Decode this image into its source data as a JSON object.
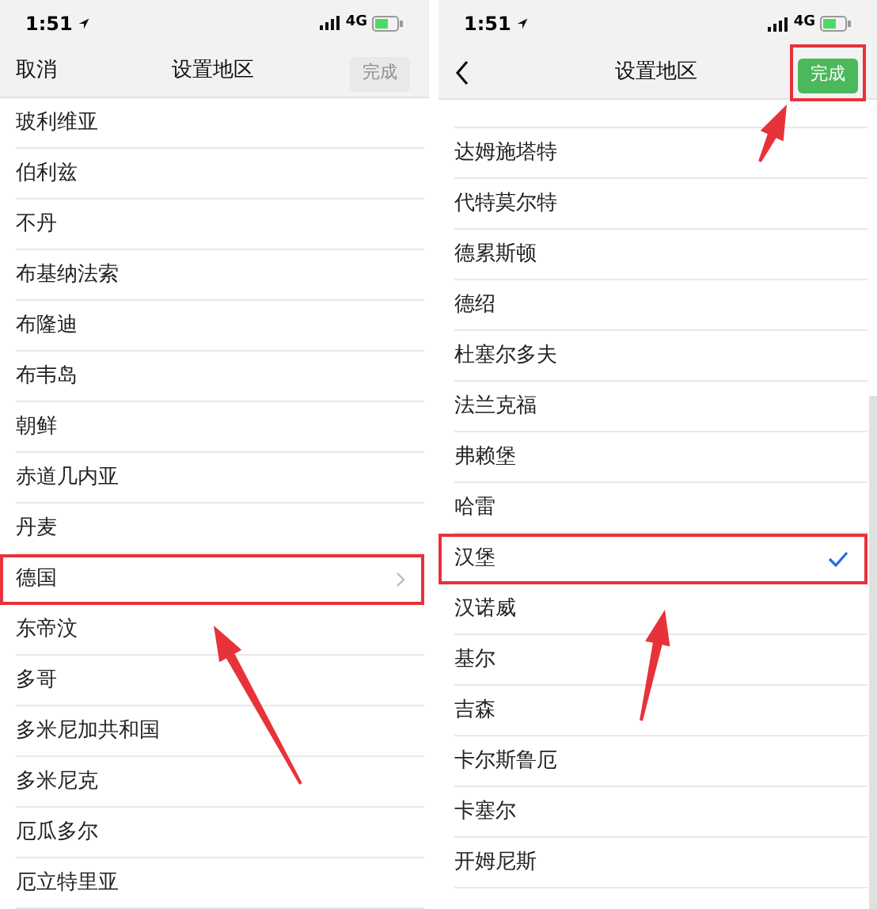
{
  "screens": [
    {
      "status_bar": {
        "time": "1:51",
        "network": "4G"
      },
      "nav": {
        "left": {
          "kind": "text",
          "label": "取消"
        },
        "title": "设置地区",
        "done": {
          "label": "完成",
          "disabled": true,
          "annotated": false
        }
      },
      "rows": [
        {
          "label": "玻利维亚",
          "chevron": false,
          "checked": false,
          "annotated": false
        },
        {
          "label": "伯利兹",
          "chevron": false,
          "checked": false,
          "annotated": false
        },
        {
          "label": "不丹",
          "chevron": false,
          "checked": false,
          "annotated": false
        },
        {
          "label": "布基纳法索",
          "chevron": false,
          "checked": false,
          "annotated": false
        },
        {
          "label": "布隆迪",
          "chevron": false,
          "checked": false,
          "annotated": false
        },
        {
          "label": "布韦岛",
          "chevron": false,
          "checked": false,
          "annotated": false
        },
        {
          "label": "朝鲜",
          "chevron": false,
          "checked": false,
          "annotated": false
        },
        {
          "label": "赤道几内亚",
          "chevron": false,
          "checked": false,
          "annotated": false
        },
        {
          "label": "丹麦",
          "chevron": false,
          "checked": false,
          "annotated": false
        },
        {
          "label": "德国",
          "chevron": true,
          "checked": false,
          "annotated": true
        },
        {
          "label": "东帝汶",
          "chevron": false,
          "checked": false,
          "annotated": false
        },
        {
          "label": "多哥",
          "chevron": false,
          "checked": false,
          "annotated": false
        },
        {
          "label": "多米尼加共和国",
          "chevron": false,
          "checked": false,
          "annotated": false
        },
        {
          "label": "多米尼克",
          "chevron": false,
          "checked": false,
          "annotated": false
        },
        {
          "label": "厄瓜多尔",
          "chevron": false,
          "checked": false,
          "annotated": false
        },
        {
          "label": "厄立特里亚",
          "chevron": false,
          "checked": false,
          "annotated": false
        }
      ]
    },
    {
      "status_bar": {
        "time": "1:51",
        "network": "4G"
      },
      "nav": {
        "left": {
          "kind": "back"
        },
        "title": "设置地区",
        "done": {
          "label": "完成",
          "disabled": false,
          "annotated": true
        }
      },
      "rows": [
        {
          "label": "达姆施塔特",
          "chevron": false,
          "checked": false,
          "annotated": false
        },
        {
          "label": "代特莫尔特",
          "chevron": false,
          "checked": false,
          "annotated": false
        },
        {
          "label": "德累斯顿",
          "chevron": false,
          "checked": false,
          "annotated": false
        },
        {
          "label": "德绍",
          "chevron": false,
          "checked": false,
          "annotated": false
        },
        {
          "label": "杜塞尔多夫",
          "chevron": false,
          "checked": false,
          "annotated": false
        },
        {
          "label": "法兰克福",
          "chevron": false,
          "checked": false,
          "annotated": false
        },
        {
          "label": "弗赖堡",
          "chevron": false,
          "checked": false,
          "annotated": false
        },
        {
          "label": "哈雷",
          "chevron": false,
          "checked": false,
          "annotated": false
        },
        {
          "label": "汉堡",
          "chevron": false,
          "checked": true,
          "annotated": true
        },
        {
          "label": "汉诺威",
          "chevron": false,
          "checked": false,
          "annotated": false
        },
        {
          "label": "基尔",
          "chevron": false,
          "checked": false,
          "annotated": false
        },
        {
          "label": "吉森",
          "chevron": false,
          "checked": false,
          "annotated": false
        },
        {
          "label": "卡尔斯鲁厄",
          "chevron": false,
          "checked": false,
          "annotated": false
        },
        {
          "label": "卡塞尔",
          "chevron": false,
          "checked": false,
          "annotated": false
        },
        {
          "label": "开姆尼斯",
          "chevron": false,
          "checked": false,
          "annotated": false
        }
      ]
    }
  ]
}
